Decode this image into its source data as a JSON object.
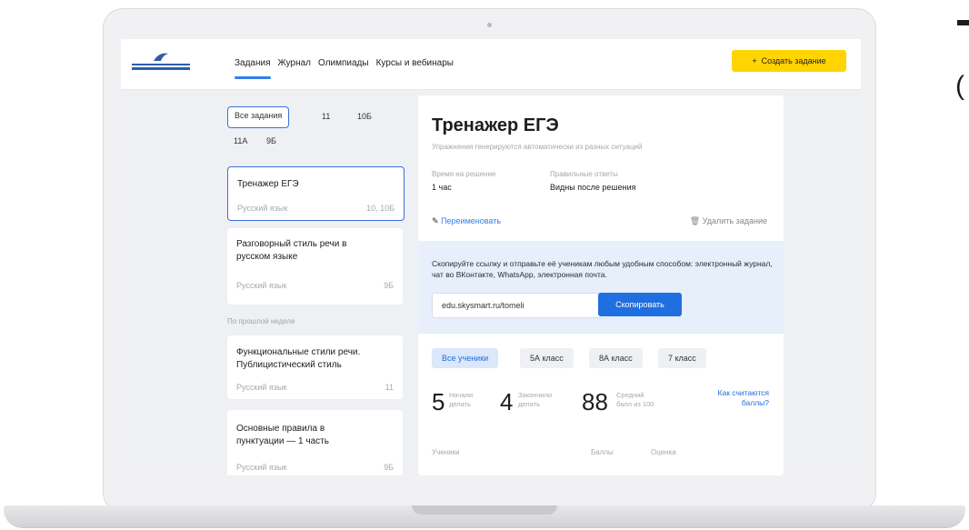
{
  "header": {
    "nav": [
      "Задания",
      "Журнал",
      "Олимпиады",
      "Курсы и вебинары"
    ],
    "create_button": "Создать задание",
    "create_icon": "plus-icon"
  },
  "filters": [
    "Все задания",
    "11",
    "10Б",
    "11А",
    "9Б"
  ],
  "cards": [
    {
      "title": "Тренажер ЕГЭ",
      "subject": "Русский язык",
      "count": "10, 10Б"
    },
    {
      "title": "Разговорный стиль речи в русском языке",
      "subject": "Русский язык",
      "count": "9Б"
    },
    {
      "title": "Функциональные стили речи. Публицистический стиль",
      "subject": "Русский язык",
      "count": "11"
    },
    {
      "title": "Основные правила в пунктуации — 1 часть",
      "subject": "Русский язык",
      "count": "9Б"
    }
  ],
  "section_label": "По прошлой неделе",
  "main": {
    "title": "Тренажер ЕГЭ",
    "description": "Упражнения генерируются автоматически из разных ситуаций",
    "time_label": "Время на решение",
    "time_value": "1 час",
    "answers_label": "Правильные ответы",
    "answers_value": "Видны после решения",
    "rename": "Переименовать",
    "delete": "Удалить задание",
    "share_text": "Скопируйте ссылку и отправьте её ученикам любым удобным способом: электронный журнал, чат во ВКонтакте, WhatsApp, электронная почта.",
    "link": "edu.skysmart.ru/tomeli",
    "copy_button": "Скопировать",
    "class_chips": [
      "Все ученики",
      "5А класс",
      "8А класс",
      "7 класс"
    ],
    "stats": [
      {
        "n": "5",
        "label": "Начали делать"
      },
      {
        "n": "4",
        "label": "Закончили делать"
      },
      {
        "n": "88",
        "label": "Средний балл из 100"
      }
    ],
    "how_link": "Как считаются баллы?",
    "table_headers": [
      "Ученики",
      "Баллы",
      "Оценка"
    ]
  },
  "edge_text": "("
}
